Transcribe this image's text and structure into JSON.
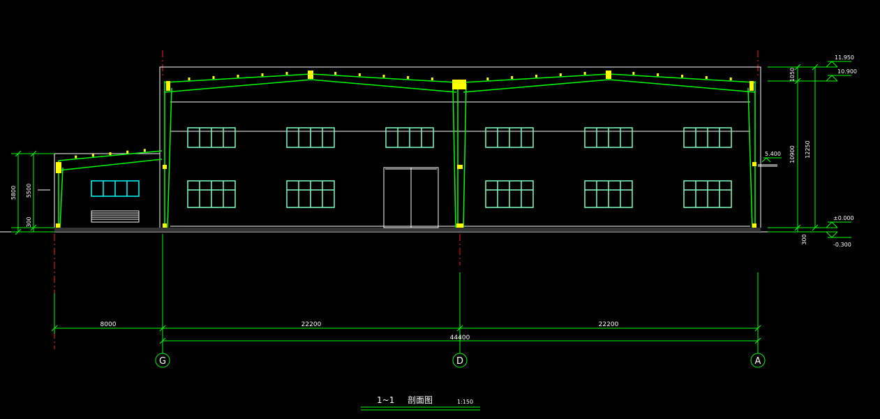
{
  "drawing": {
    "title": {
      "number": "1~1",
      "name": "剖面图",
      "scale": "1:150"
    },
    "dimensions": {
      "bays": [
        "8000",
        "22200",
        "22200"
      ],
      "total": "44400",
      "right_vertical": [
        "1050",
        "10900",
        "12250",
        "300"
      ],
      "left_vertical": [
        "5800",
        "5500",
        "300"
      ]
    },
    "elevations": {
      "ridge_top": "11.950",
      "eave_top": "10.900",
      "crane": "5.400",
      "ground": "±0.000",
      "outdoor": "-0.300"
    },
    "axes": [
      "G",
      "D",
      "A"
    ],
    "colors": {
      "background": "#000000",
      "steel_frame": "#00ff00",
      "outline": "#ffffff",
      "windows": "#80ffc0",
      "annex_windows": "#00ffff",
      "axis_centerline": "#ff0000",
      "purlin_marks": "#ffff00",
      "dim_lines": "#00ff00"
    }
  }
}
